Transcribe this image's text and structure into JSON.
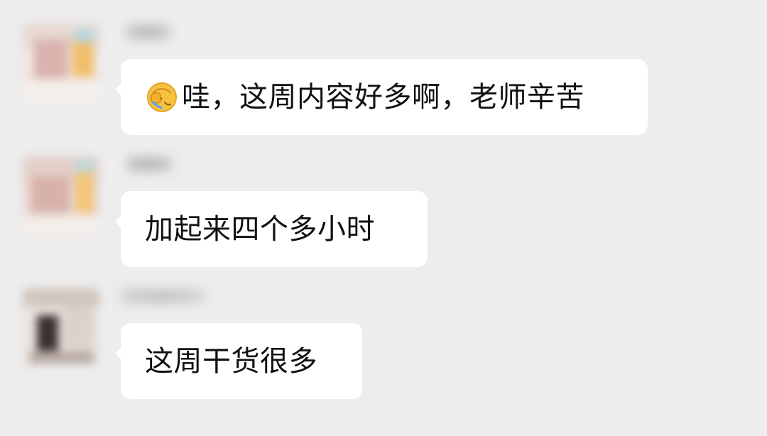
{
  "messages": [
    {
      "text": "哇，这周内容好多啊，老师辛苦",
      "emoji_icon": "facepalm-emoji-icon"
    },
    {
      "text": "加起来四个多小时"
    },
    {
      "text": "这周干货很多"
    }
  ],
  "colors": {
    "background": "#ededed",
    "bubble": "#ffffff",
    "text": "#111111"
  }
}
